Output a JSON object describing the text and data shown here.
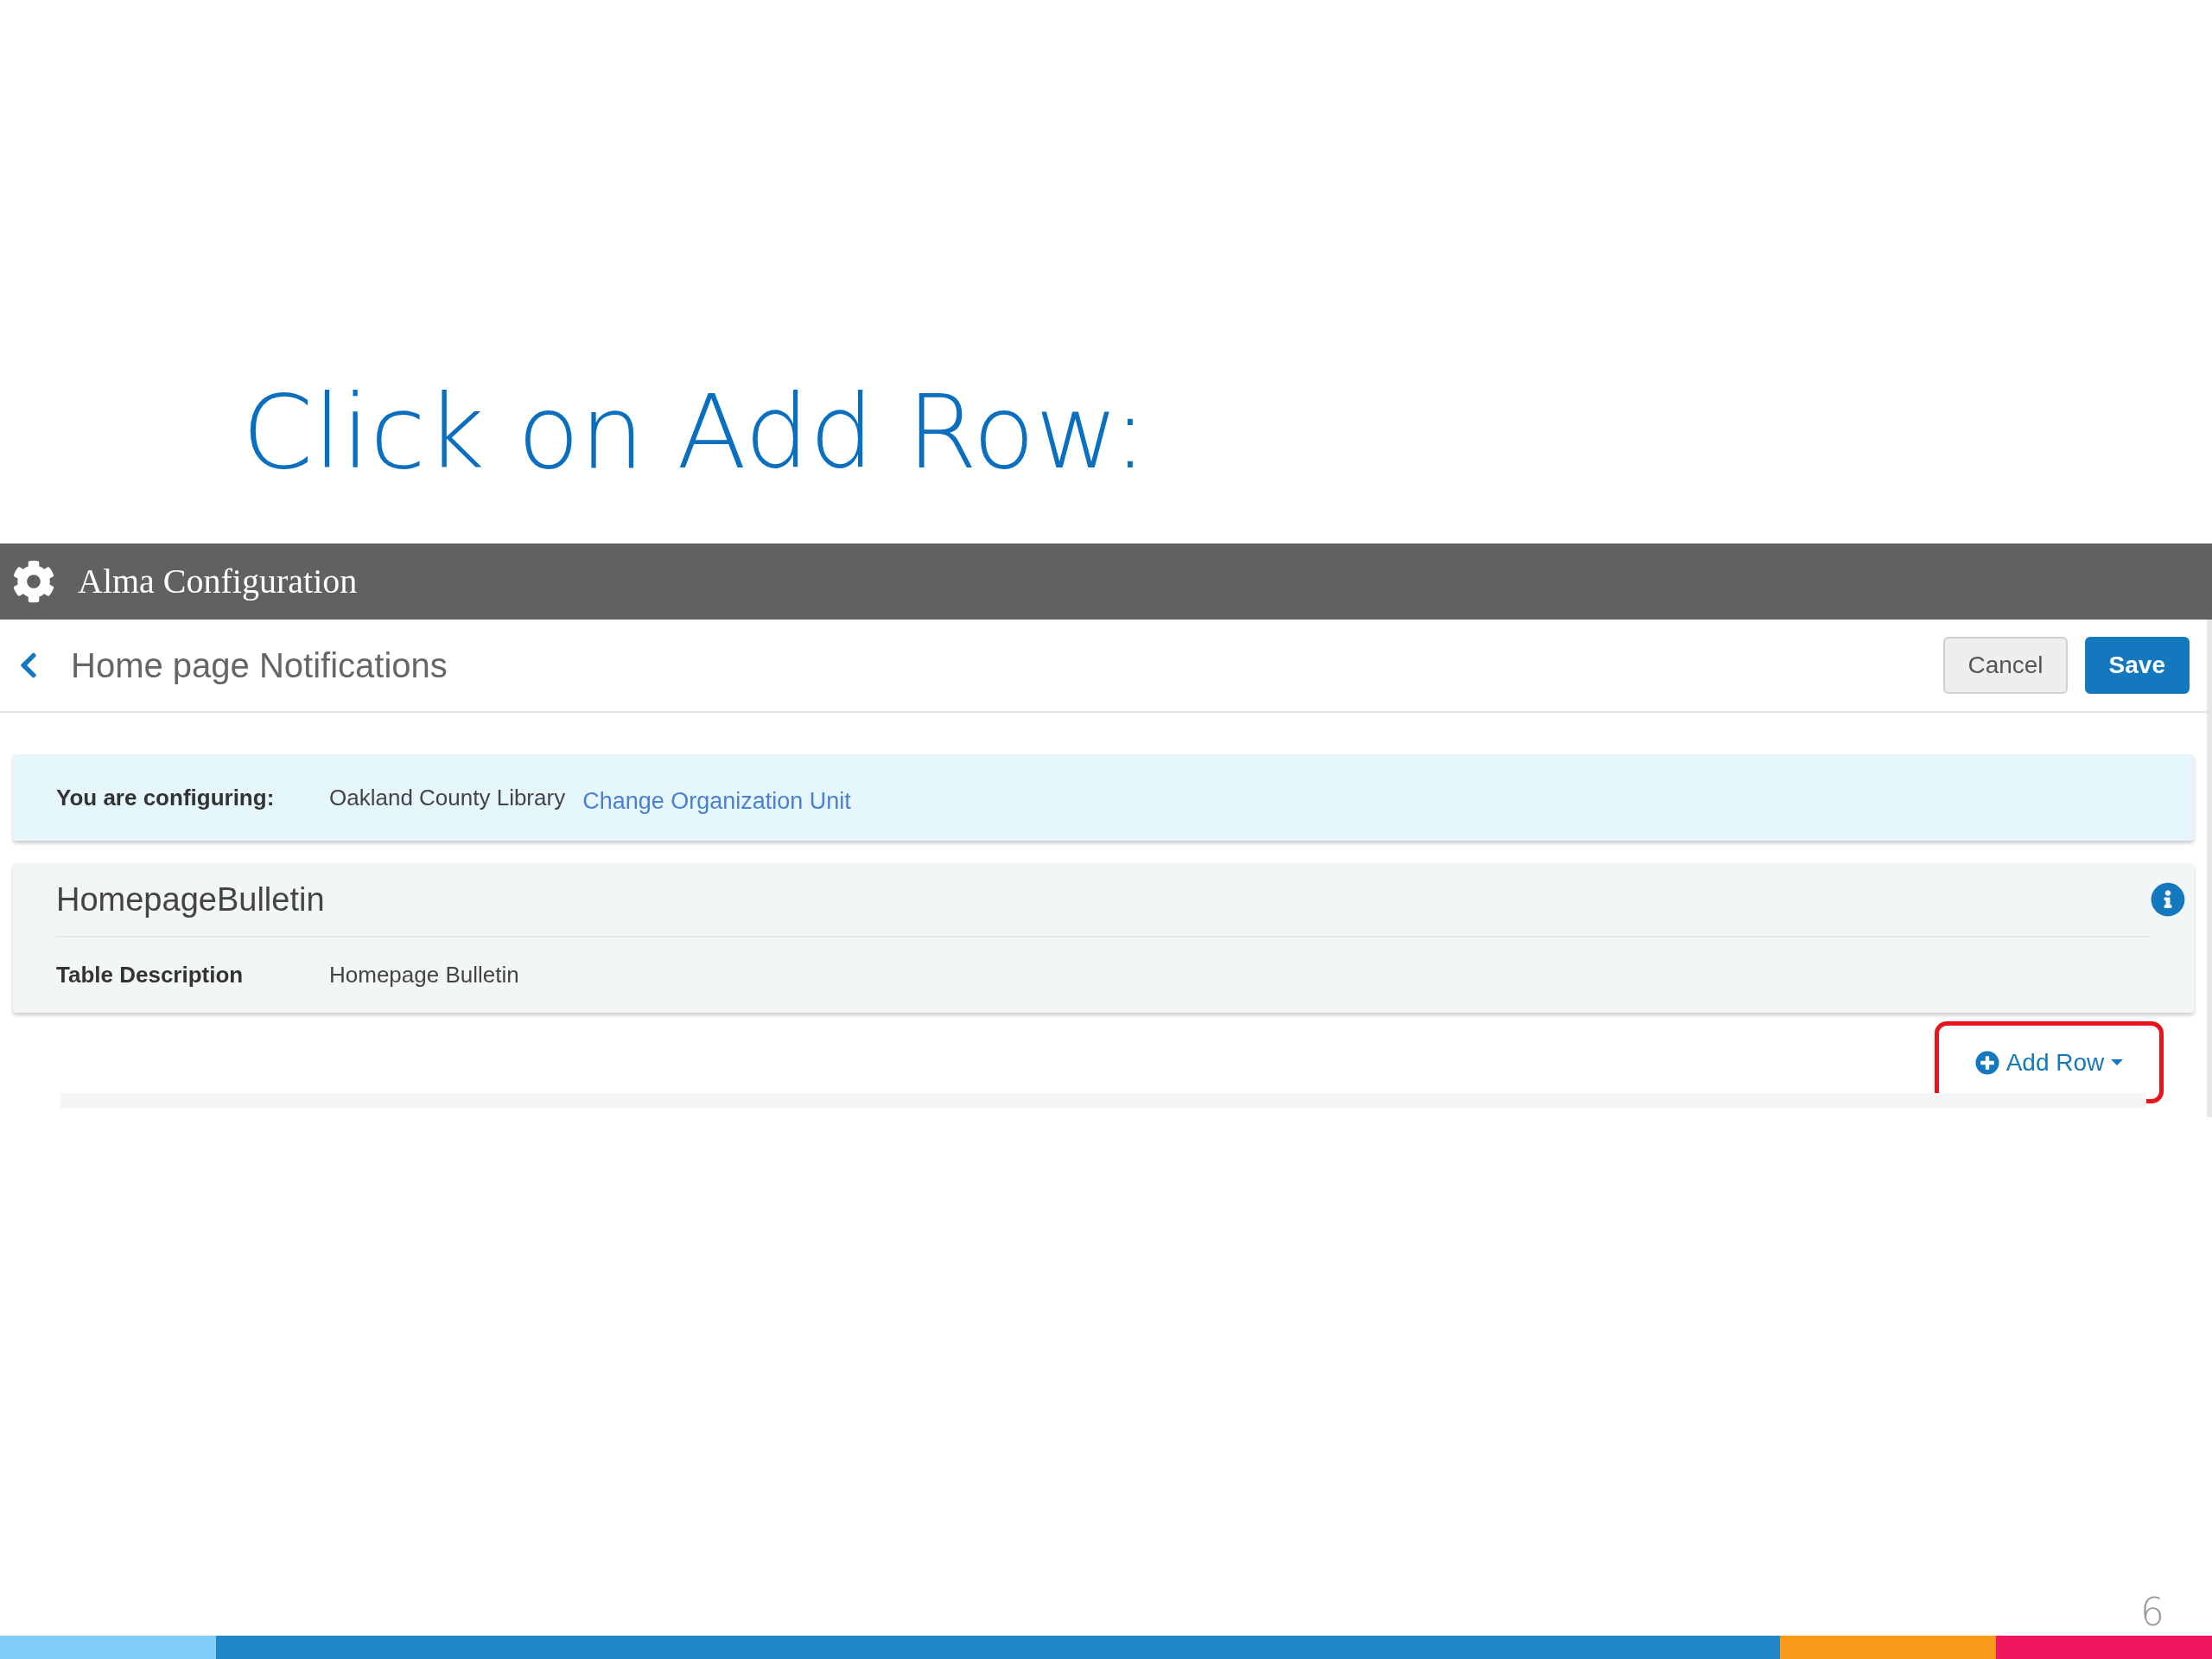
{
  "slide": {
    "title": "Click on Add Row:",
    "page_number": "6"
  },
  "app_header": {
    "title": "Alma Configuration"
  },
  "page_header": {
    "title": "Home page Notifications",
    "buttons": [
      {
        "label": "Cancel",
        "kind": "secondary"
      },
      {
        "label": "Save",
        "kind": "primary"
      }
    ]
  },
  "configuring": {
    "label": "You are configuring:",
    "value": "Oakland County Library",
    "link": "Change Organization Unit"
  },
  "table": {
    "name": "HomepageBulletin",
    "description_label": "Table Description",
    "description_value": "Homepage Bulletin"
  },
  "add_row": {
    "label": "Add Row"
  }
}
